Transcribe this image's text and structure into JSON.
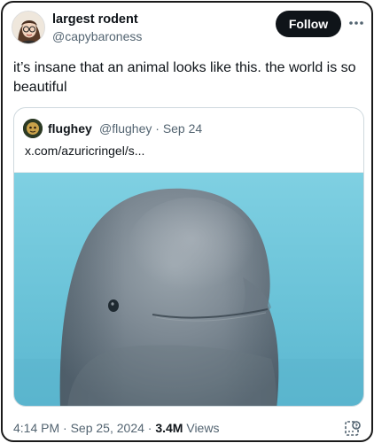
{
  "tweet": {
    "author_name": "largest rodent",
    "author_handle": "@capybaroness",
    "follow_label": "Follow",
    "more_icon": "more-icon",
    "text": "it’s insane that an animal looks like this. the world is so beautiful"
  },
  "quote": {
    "author_name": "flughey",
    "author_handle": "@flughey",
    "separator": "·",
    "date": "Sep 24",
    "link_text": "x.com/azuricringel/s...",
    "media": "beluga-whale-photo"
  },
  "footer": {
    "time": "4:14 PM",
    "separator": "·",
    "date": "Sep 25, 2024",
    "separator2": "·",
    "views_count": "3.4M",
    "views_label": "Views",
    "action_icon": "grok-icon"
  },
  "colors": {
    "text_primary": "#0f1419",
    "text_secondary": "#536471",
    "follow_bg": "#0f1419",
    "border": "#cfd9de",
    "water": "#6ec3d8"
  }
}
